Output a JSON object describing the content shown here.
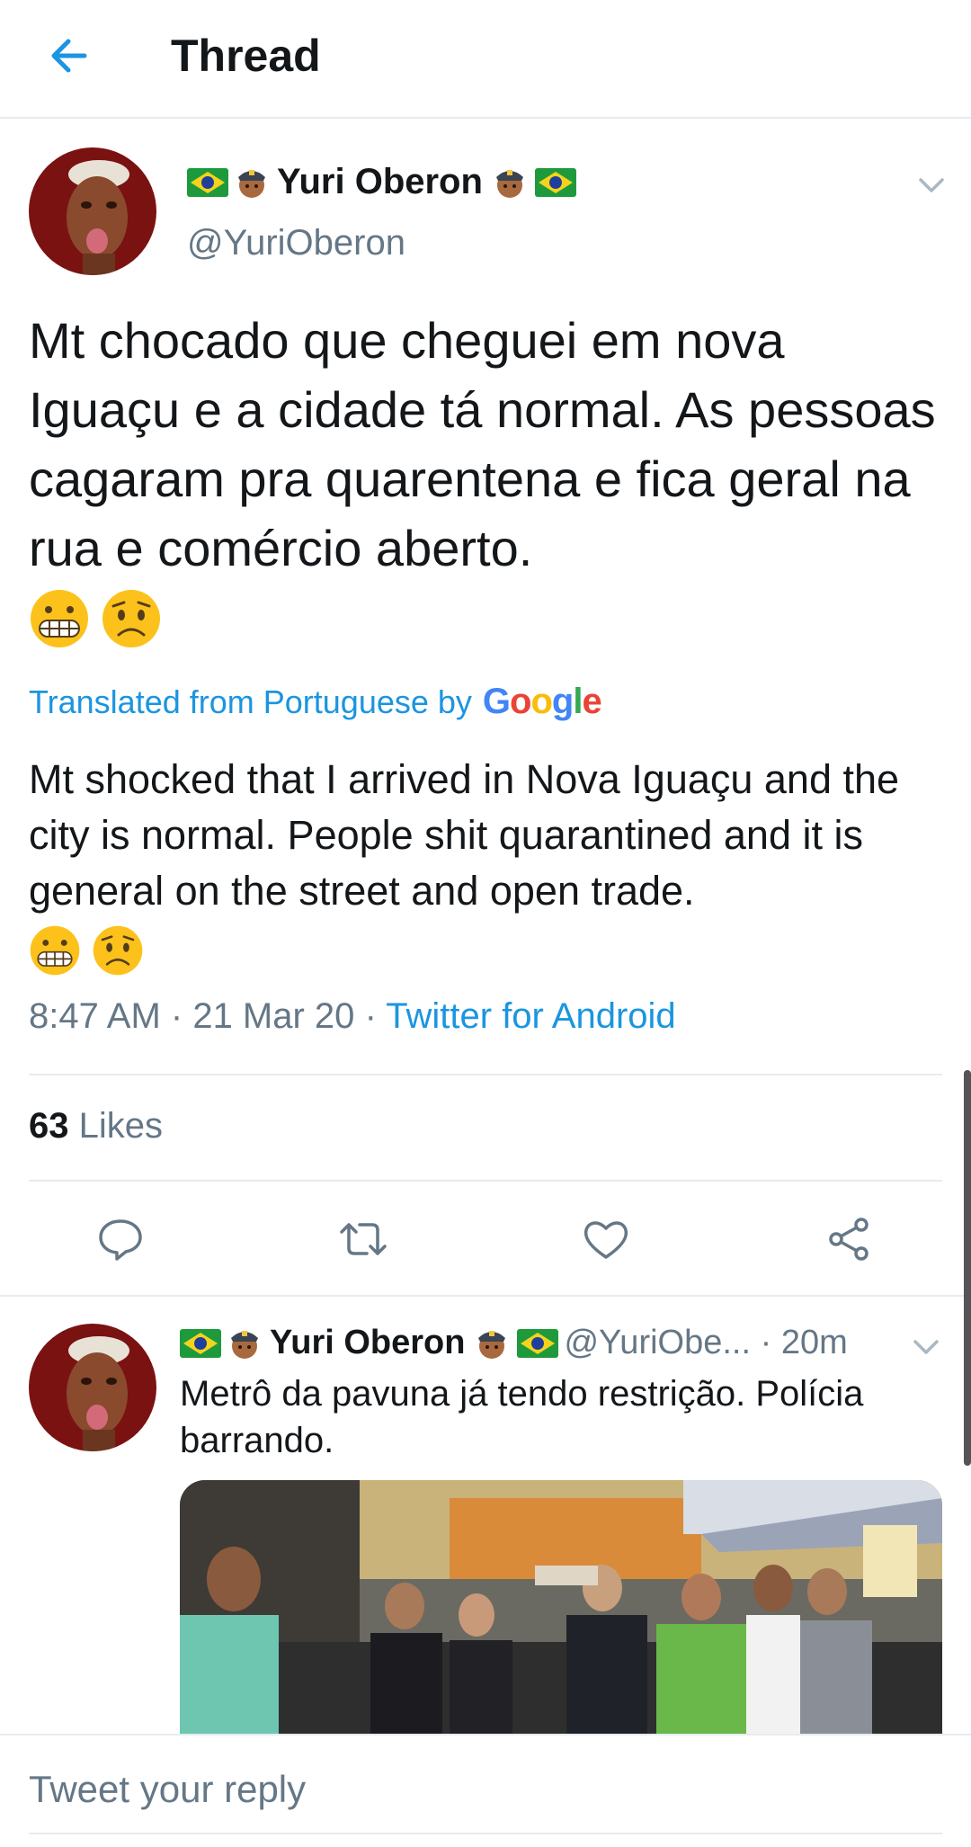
{
  "header": {
    "title": "Thread"
  },
  "tweet": {
    "display_name": "Yuri Oberon",
    "handle": "@YuriOberon",
    "text": "Mt chocado que cheguei em nova Iguaçu e a cidade tá normal. As pessoas cagaram pra quarentena e fica geral na rua e comércio aberto.",
    "translated_label": "Translated from Portuguese by",
    "google_letters": [
      "G",
      "o",
      "o",
      "g",
      "l",
      "e"
    ],
    "translation": "Mt shocked that I arrived in Nova Iguaçu and the city is normal. People shit quarantined and it is general on the street and open trade.",
    "time": "8:47 AM",
    "date": "21 Mar 20",
    "source": "Twitter for Android",
    "likes_count": "63",
    "likes_label": "Likes"
  },
  "reply": {
    "display_name": "Yuri Oberon",
    "handle": "@YuriObe...",
    "age": "20m",
    "text": "Metrô da pavuna já tendo restrição. Polícia barrando."
  },
  "composer": {
    "placeholder": "Tweet your reply"
  },
  "colors": {
    "accent": "#1b95e0",
    "text": "#14171a",
    "muted": "#657786",
    "divider": "#e6ecf0"
  },
  "icons": [
    "back-arrow-icon",
    "brazil-flag-icon",
    "police-officer-icon",
    "chevron-down-icon",
    "grimacing-emoji-icon",
    "worried-emoji-icon",
    "reply-icon",
    "retweet-icon",
    "like-icon",
    "share-icon"
  ]
}
